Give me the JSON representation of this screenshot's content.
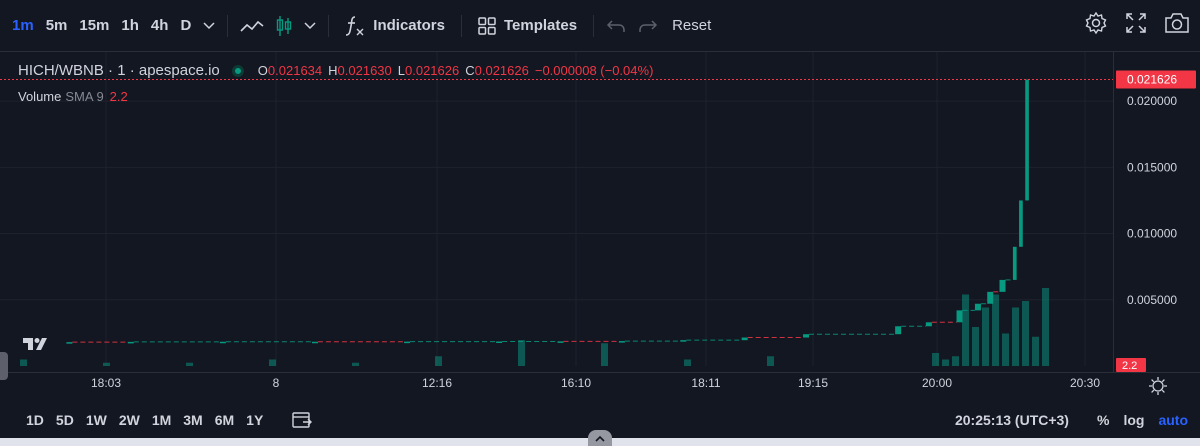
{
  "toolbar": {
    "timeframes": [
      "1m",
      "5m",
      "15m",
      "1h",
      "4h",
      "D"
    ],
    "active_timeframe": "1m",
    "indicators_label": "Indicators",
    "templates_label": "Templates",
    "reset_label": "Reset"
  },
  "legend": {
    "symbol": "HICH/WBNB",
    "interval": "1",
    "exchange": "apespace.io",
    "open_label": "O",
    "open": "0.021634",
    "high_label": "H",
    "high": "0.021630",
    "low_label": "L",
    "low": "0.021626",
    "close_label": "C",
    "close": "0.021626",
    "change": "−0.000008 (−0.04%)",
    "volume_label": "Volume",
    "volume_sma": "SMA 9",
    "volume_value": "2.2"
  },
  "bottom": {
    "ranges": [
      "1D",
      "5D",
      "1W",
      "2W",
      "1M",
      "3M",
      "6M",
      "1Y"
    ],
    "clock": "20:25:13 (UTC+3)",
    "pct_label": "%",
    "log_label": "log",
    "auto_label": "auto"
  },
  "colors": {
    "up": "#089981",
    "down": "#f23645",
    "accent": "#2962ff"
  },
  "chart_data": {
    "type": "candlestick",
    "title": "HICH/WBNB · 1 · apespace.io",
    "xlabel": "",
    "ylabel": "",
    "xlim": [
      "17:40",
      "20:40"
    ],
    "ylim": [
      0,
      0.0225
    ],
    "x_ticks": [
      "18:03",
      "8",
      "12:16",
      "16:10",
      "18:11",
      "19:15",
      "20:00",
      "20:30"
    ],
    "y_ticks": [
      "0.020000",
      "0.015000",
      "0.010000",
      "0.005000"
    ],
    "last_price_label": "0.021626",
    "volume_last_label": "2.2",
    "grid": true,
    "series": [
      {
        "name": "HICH/WBNB",
        "candles": [
          {
            "x": "17:50",
            "o": 0.0018,
            "c": 0.0018
          },
          {
            "x": "18:00",
            "o": 0.0018,
            "c": 0.00182
          },
          {
            "x": "18:15",
            "o": 0.00182,
            "c": 0.00183
          },
          {
            "x": "18:30",
            "o": 0.00183,
            "c": 0.00183
          },
          {
            "x": "18:45",
            "o": 0.00183,
            "c": 0.00184
          },
          {
            "x": "19:00",
            "o": 0.00184,
            "c": 0.00185
          },
          {
            "x": "19:10",
            "o": 0.00185,
            "c": 0.00186
          },
          {
            "x": "19:20",
            "o": 0.00186,
            "c": 0.00188
          },
          {
            "x": "19:30",
            "o": 0.00188,
            "c": 0.00195
          },
          {
            "x": "19:40",
            "o": 0.00195,
            "c": 0.00215
          },
          {
            "x": "19:50",
            "o": 0.00215,
            "c": 0.0024
          },
          {
            "x": "20:05",
            "o": 0.0024,
            "c": 0.003
          },
          {
            "x": "20:10",
            "o": 0.003,
            "c": 0.0033
          },
          {
            "x": "20:15",
            "o": 0.0033,
            "c": 0.0042
          },
          {
            "x": "20:18",
            "o": 0.0042,
            "c": 0.0047
          },
          {
            "x": "20:20",
            "o": 0.0047,
            "c": 0.0056
          },
          {
            "x": "20:22",
            "o": 0.0056,
            "c": 0.0065
          },
          {
            "x": "20:24",
            "o": 0.0065,
            "c": 0.009
          },
          {
            "x": "20:25",
            "o": 0.009,
            "c": 0.0125
          },
          {
            "x": "20:26",
            "o": 0.0125,
            "c": 0.02163
          }
        ],
        "volumes": [
          2,
          1,
          1,
          2,
          1,
          3,
          8,
          7,
          2,
          3,
          4,
          2,
          3,
          22,
          12,
          18,
          22,
          10,
          18,
          20,
          9,
          24
        ]
      }
    ]
  }
}
